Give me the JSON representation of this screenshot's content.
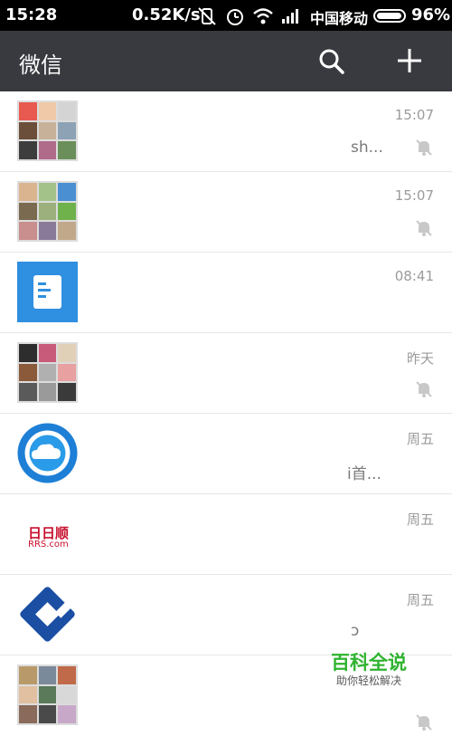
{
  "status_bar": {
    "time": "15:28",
    "speed": "0.52K/s",
    "carrier": "中国移动",
    "battery_percent": "96%",
    "battery_level": 0.96
  },
  "header": {
    "title": "微信",
    "search_icon": "search-icon",
    "add_icon": "plus-icon"
  },
  "chats": [
    {
      "time": "15:07",
      "snippet": "sh...",
      "muted": true,
      "avatar": "group-grid"
    },
    {
      "time": "15:07",
      "snippet": "",
      "muted": true,
      "avatar": "group-grid"
    },
    {
      "time": "08:41",
      "snippet": "",
      "muted": false,
      "avatar": "document-icon-blue"
    },
    {
      "time": "昨天",
      "snippet": "",
      "muted": true,
      "avatar": "group-grid"
    },
    {
      "time": "周五",
      "snippet": "i首...",
      "muted": false,
      "avatar": "cloud-logo"
    },
    {
      "time": "周五",
      "snippet": "",
      "muted": false,
      "avatar": "rrs-logo",
      "avatar_text_1": "日日顺",
      "avatar_text_2": "RRS.com"
    },
    {
      "time": "周五",
      "snippet": "ɔ",
      "muted": false,
      "avatar": "ccb-logo"
    },
    {
      "time": "",
      "snippet": "",
      "muted": true,
      "avatar": "group-grid"
    }
  ],
  "watermark": {
    "title": "百科全说",
    "subtitle": "助你轻松解决"
  },
  "colors": {
    "header_bg": "#393a3f",
    "status_bg": "#000000",
    "watermark_green": "#2fb32f"
  }
}
